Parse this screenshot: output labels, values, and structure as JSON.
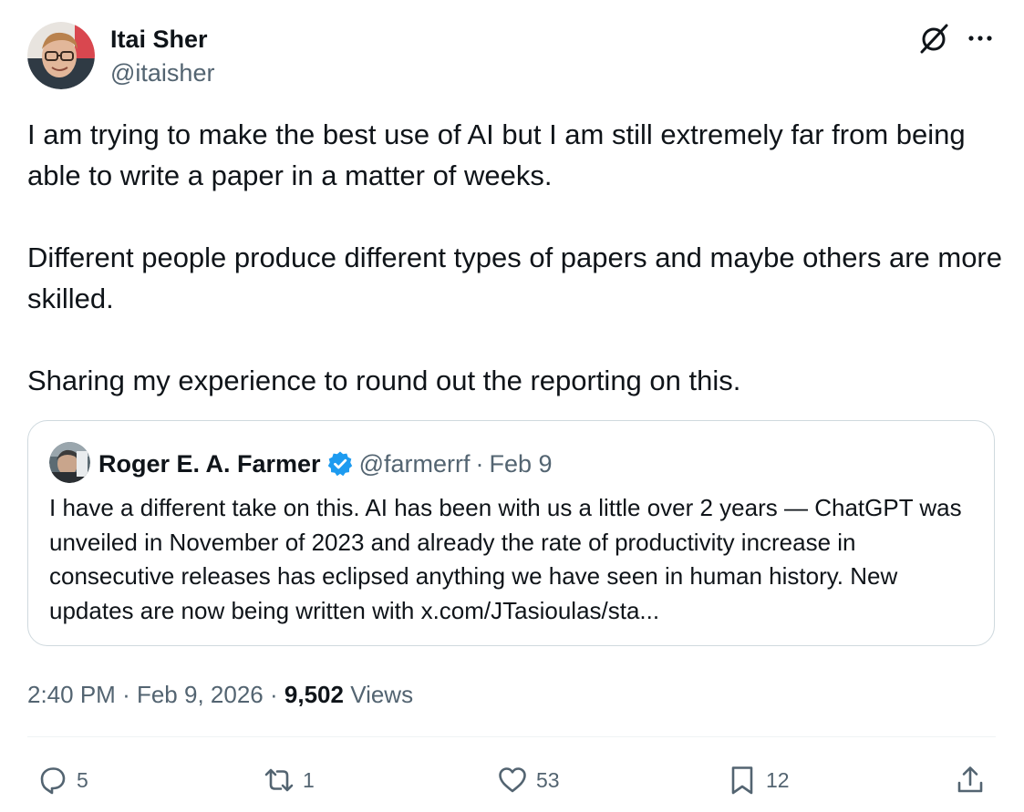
{
  "author": {
    "name": "Itai Sher",
    "handle": "@itaisher"
  },
  "header_icons": {
    "grok": "grok-icon",
    "more": "more-options-icon"
  },
  "tweet": {
    "paragraphs": [
      "I am trying to make the best use of AI but I am still extremely far from being able to write a paper in a matter of weeks.",
      "Different people produce different types of papers and maybe others are more skilled.",
      "Sharing my experience to round out the reporting on this."
    ]
  },
  "quoted_tweet": {
    "name": "Roger E. A. Farmer",
    "verified": true,
    "handle": "@farmerrf",
    "separator": "·",
    "date": "Feb 9",
    "text": "I have a different take on this. AI has been with us a little over 2 years — ChatGPT was unveiled in November of 2023 and already the rate of productivity increase in consecutive releases has eclipsed anything we have seen in human history. New updates are now being written with x.com/JTasioulas/sta..."
  },
  "meta": {
    "time": "2:40 PM",
    "separator": "·",
    "date": "Feb 9, 2026",
    "separator2": "·",
    "views_count": "9,502",
    "views_label": "Views"
  },
  "actions": {
    "replies": "5",
    "reposts": "1",
    "likes": "53",
    "bookmarks": "12"
  },
  "colors": {
    "text_primary": "#0f1419",
    "text_secondary": "#536471",
    "verified_blue": "#1d9bf0",
    "border": "#cfd9de"
  }
}
